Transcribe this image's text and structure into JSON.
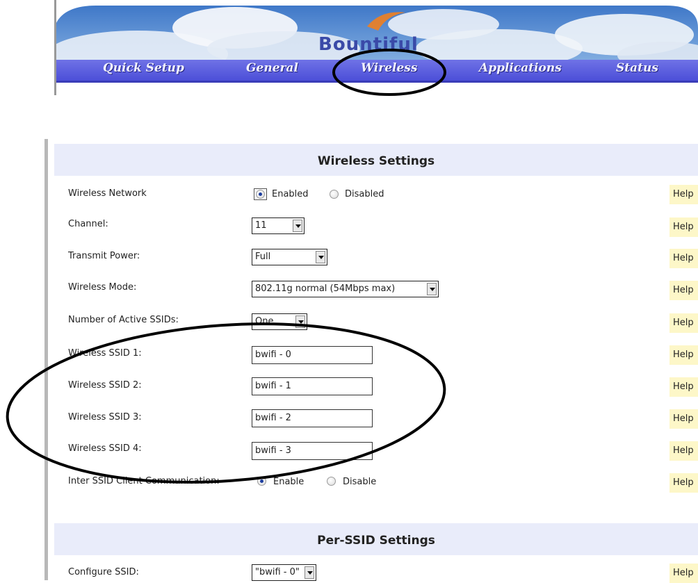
{
  "brand": {
    "logo_text": "Bountiful"
  },
  "nav": {
    "items": [
      "Quick Setup",
      "General",
      "Wireless",
      "Applications",
      "Status"
    ]
  },
  "wireless_settings": {
    "title": "Wireless Settings",
    "help_label": "Help",
    "rows": {
      "wireless_network": {
        "label": "Wireless Network",
        "options": [
          "Enabled",
          "Disabled"
        ],
        "selected": "Enabled"
      },
      "channel": {
        "label": "Channel:",
        "value": "11"
      },
      "transmit_power": {
        "label": "Transmit Power:",
        "value": "Full"
      },
      "wireless_mode": {
        "label": "Wireless Mode:",
        "value": "802.11g normal (54Mbps max)"
      },
      "active_ssids": {
        "label": "Number of Active SSIDs:",
        "value": "One"
      },
      "ssid1": {
        "label": "Wireless SSID 1:",
        "value": "bwifi - 0"
      },
      "ssid2": {
        "label": "Wireless SSID 2:",
        "value": "bwifi - 1"
      },
      "ssid3": {
        "label": "Wireless SSID 3:",
        "value": "bwifi - 2"
      },
      "ssid4": {
        "label": "Wireless SSID 4:",
        "value": "bwifi - 3"
      },
      "inter_ssid": {
        "label": "Inter SSID Client Communication:",
        "options": [
          "Enable",
          "Disable"
        ],
        "selected": "Enable"
      }
    }
  },
  "per_ssid_settings": {
    "title": "Per-SSID Settings",
    "configure_ssid": {
      "label": "Configure SSID:",
      "value": "\"bwifi - 0\""
    },
    "help_label": "Help"
  }
}
